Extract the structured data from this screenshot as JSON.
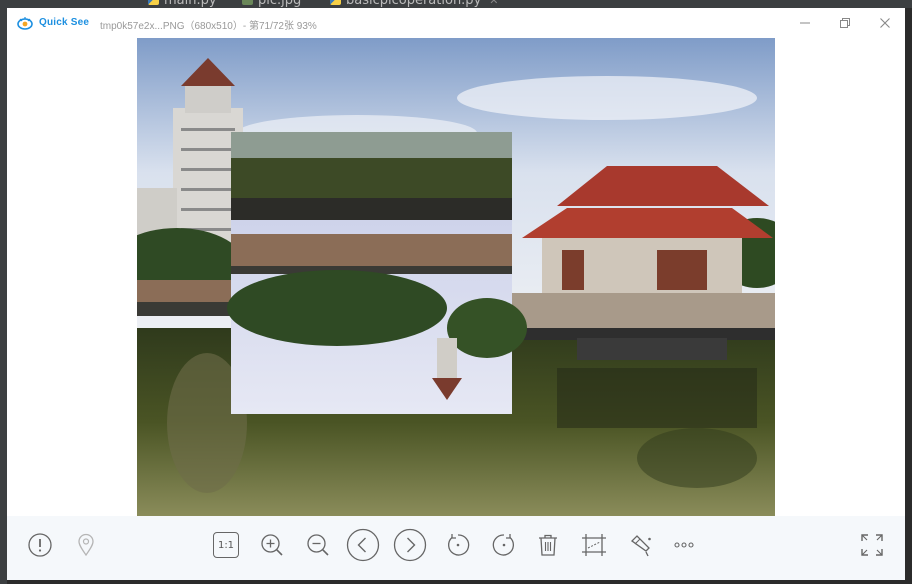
{
  "ide": {
    "tabs": [
      {
        "label": "main.py"
      },
      {
        "label": "pic.jpg"
      },
      {
        "label": "basicpicoperation.py"
      }
    ]
  },
  "window": {
    "app_name": "Quick See",
    "file_info": "tmp0k57e2x...PNG（680x510）- 第71/72张 93%",
    "controls": [
      "minimize-icon",
      "restore-icon",
      "close-icon"
    ]
  },
  "toolbar": {
    "actual_size_label": "1:1",
    "buttons": [
      "info-icon",
      "location-icon",
      "actual-size-icon",
      "zoom-in-icon",
      "zoom-out-icon",
      "previous-icon",
      "next-icon",
      "rotate-left-icon",
      "rotate-right-icon",
      "delete-icon",
      "crop-icon",
      "edit-icon",
      "more-icon",
      "fullscreen-icon"
    ]
  },
  "colors": {
    "brand": "#1c8fe0",
    "toolbar_bg": "#f5f8fb",
    "icon": "#666666"
  }
}
